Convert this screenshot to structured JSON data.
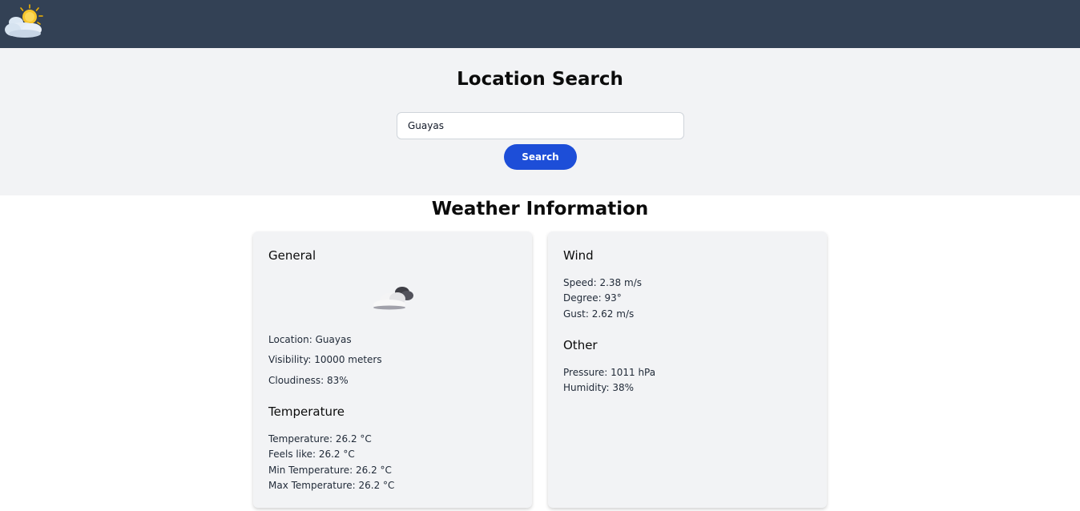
{
  "header": {
    "logo_icon": "sun-behind-cloud-icon"
  },
  "search": {
    "title": "Location Search",
    "input_value": "Guayas",
    "button_label": "Search"
  },
  "weather": {
    "title": "Weather Information",
    "general": {
      "heading": "General",
      "icon": "cloud-icon",
      "location": "Location: Guayas",
      "visibility": "Visibility: 10000 meters",
      "cloudiness": "Cloudiness: 83%"
    },
    "temperature": {
      "heading": "Temperature",
      "temperature": "Temperature: 26.2 °C",
      "feels_like": "Feels like: 26.2 °C",
      "min": "Min Temperature: 26.2 °C",
      "max": "Max Temperature: 26.2 °C"
    },
    "wind": {
      "heading": "Wind",
      "speed": "Speed: 2.38 m/s",
      "degree": "Degree: 93°",
      "gust": "Gust: 2.62 m/s"
    },
    "other": {
      "heading": "Other",
      "pressure": "Pressure: 1011 hPa",
      "humidity": "Humidity: 38%"
    }
  },
  "colors": {
    "topbar": "#334155",
    "accent": "#1d4ed8",
    "panel": "#f2f3f5"
  }
}
